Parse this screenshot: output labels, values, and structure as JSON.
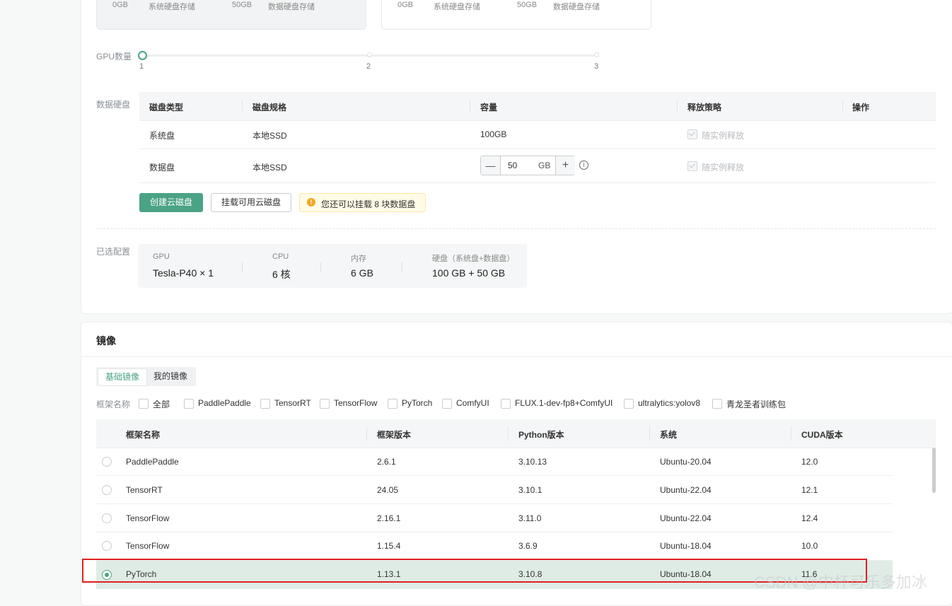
{
  "storage_cards": [
    {
      "system_disk_value": "0GB",
      "system_disk_label": "系统硬盘存储",
      "data_disk_value": "50GB",
      "data_disk_label": "数据硬盘存储"
    },
    {
      "system_disk_value": "0GB",
      "system_disk_label": "系统硬盘存储",
      "data_disk_value": "50GB",
      "data_disk_label": "数据硬盘存储"
    }
  ],
  "gpu_count": {
    "label": "GPU数量",
    "ticks": [
      "1",
      "2",
      "3"
    ],
    "selected": 1
  },
  "data_disk": {
    "label": "数据硬盘",
    "headers": [
      "磁盘类型",
      "磁盘规格",
      "容量",
      "释放策略",
      "操作"
    ],
    "rows": [
      {
        "type": "系统盘",
        "spec": "本地SSD",
        "capacity": "100GB",
        "policy": "随实例释放"
      },
      {
        "type": "数据盘",
        "spec": "本地SSD",
        "capacity_value": "50",
        "capacity_unit": "GB",
        "policy": "随实例释放"
      }
    ],
    "create_button": "创建云磁盘",
    "mount_button": "挂载可用云磁盘",
    "notice": "您还可以挂载 8 块数据盘",
    "stepper_minus": "—",
    "stepper_plus": "+"
  },
  "selected_config": {
    "label": "已选配置",
    "items": [
      {
        "label": "GPU",
        "value": "Tesla-P40 × 1"
      },
      {
        "label": "CPU",
        "value": "6 核"
      },
      {
        "label": "内存",
        "value": "6 GB"
      },
      {
        "label": "硬盘（系统盘+数据盘）",
        "value": "100 GB + 50 GB"
      }
    ]
  },
  "image_section": {
    "title": "镜像",
    "tabs": [
      "基础镜像",
      "我的镜像"
    ],
    "active_tab": 0,
    "filter_label": "框架名称",
    "filters": [
      "全部",
      "PaddlePaddle",
      "TensorRT",
      "TensorFlow",
      "PyTorch",
      "ComfyUI",
      "FLUX.1-dev-fp8+ComfyUI",
      "ultralytics:yolov8",
      "青龙圣者训练包"
    ],
    "headers": [
      "框架名称",
      "框架版本",
      "Python版本",
      "系统",
      "CUDA版本"
    ],
    "rows": [
      {
        "name": "PaddlePaddle",
        "version": "2.6.1",
        "python": "3.10.13",
        "os": "Ubuntu-20.04",
        "cuda": "12.0",
        "selected": false
      },
      {
        "name": "TensorRT",
        "version": "24.05",
        "python": "3.10.1",
        "os": "Ubuntu-22.04",
        "cuda": "12.1",
        "selected": false
      },
      {
        "name": "TensorFlow",
        "version": "2.16.1",
        "python": "3.11.0",
        "os": "Ubuntu-22.04",
        "cuda": "12.4",
        "selected": false
      },
      {
        "name": "TensorFlow",
        "version": "1.15.4",
        "python": "3.6.9",
        "os": "Ubuntu-18.04",
        "cuda": "10.0",
        "selected": false
      },
      {
        "name": "PyTorch",
        "version": "1.13.1",
        "python": "3.10.8",
        "os": "Ubuntu-18.04",
        "cuda": "11.6",
        "selected": true
      }
    ]
  },
  "watermark": "CSDN @中杯可乐多加冰",
  "colors": {
    "accent": "#4aa384",
    "highlight": "#e02020",
    "notice_bg": "#fffbe6",
    "notice_icon": "#f5a623"
  }
}
